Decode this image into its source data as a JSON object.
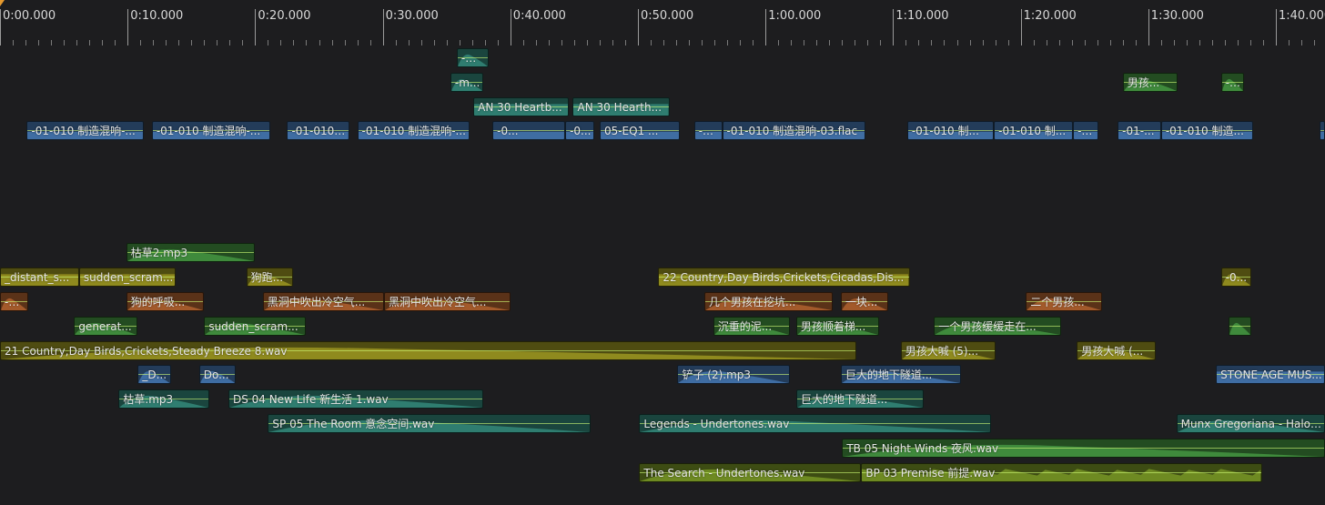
{
  "timeline": {
    "time_labels": [
      "0:00.000",
      "0:10.000",
      "0:20.000",
      "0:30.000",
      "0:40.000",
      "0:50.000",
      "1:00.000",
      "1:10.000",
      "1:20.000",
      "1:30.000",
      "1:40.000"
    ]
  },
  "colors": {
    "blue": "#3f6da3",
    "green": "#3f8a3c",
    "teal": "#2f7d70",
    "orange": "#a35a2b",
    "olive": "#8f8a1e",
    "lime": "#6e8a22"
  },
  "clips": [
    {
      "label": "-m...",
      "start": 35.8,
      "end": 38.3,
      "row": 1,
      "color": "teal",
      "wave": "fade"
    },
    {
      "label": "-m...",
      "start": 35.3,
      "end": 37.9,
      "row": 2,
      "color": "teal",
      "wave": "fade"
    },
    {
      "label": "男孩...",
      "start": 88.0,
      "end": 92.3,
      "row": 2,
      "color": "green",
      "wave": "fade"
    },
    {
      "label": "-0...",
      "start": 95.7,
      "end": 97.5,
      "row": 2,
      "color": "green",
      "wave": "fade"
    },
    {
      "label": "AN 30 Heartb...",
      "start": 37.1,
      "end": 44.6,
      "row": 3,
      "color": "teal",
      "wave": "steady"
    },
    {
      "label": "AN 30 Hearth...",
      "start": 44.9,
      "end": 52.5,
      "row": 3,
      "color": "teal",
      "wave": "steady"
    },
    {
      "label": "-01-010 制造混响-...",
      "start": 2.1,
      "end": 11.3,
      "row": 4,
      "color": "blue",
      "wave": "flat"
    },
    {
      "label": "-01-010 制造混响-...",
      "start": 11.9,
      "end": 21.2,
      "row": 4,
      "color": "blue",
      "wave": "flat"
    },
    {
      "label": "-01-010 ...",
      "start": 22.5,
      "end": 27.4,
      "row": 4,
      "color": "blue",
      "wave": "flat"
    },
    {
      "label": "-01-010 制造混响-...",
      "start": 28.0,
      "end": 36.8,
      "row": 4,
      "color": "blue",
      "wave": "flat"
    },
    {
      "label": "-0...",
      "start": 38.6,
      "end": 44.3,
      "row": 4,
      "color": "blue",
      "wave": "flat"
    },
    {
      "label": "-0...",
      "start": 44.3,
      "end": 46.6,
      "row": 4,
      "color": "blue",
      "wave": "flat"
    },
    {
      "label": "05-EQ1 ...",
      "start": 47.0,
      "end": 53.3,
      "row": 4,
      "color": "blue",
      "wave": "flat"
    },
    {
      "label": "-0...",
      "start": 54.4,
      "end": 56.6,
      "row": 4,
      "color": "blue",
      "wave": "flat"
    },
    {
      "label": "-01-010 制造混响-03.flac",
      "start": 56.6,
      "end": 67.8,
      "row": 4,
      "color": "blue",
      "wave": "flat"
    },
    {
      "label": "-01-010 制...",
      "start": 71.1,
      "end": 77.9,
      "row": 4,
      "color": "blue",
      "wave": "flat"
    },
    {
      "label": "-01-010 制...",
      "start": 77.9,
      "end": 84.1,
      "row": 4,
      "color": "blue",
      "wave": "flat"
    },
    {
      "label": "-0...",
      "start": 84.1,
      "end": 86.1,
      "row": 4,
      "color": "blue",
      "wave": "flat"
    },
    {
      "label": "-01-...",
      "start": 87.6,
      "end": 91.0,
      "row": 4,
      "color": "blue",
      "wave": "flat"
    },
    {
      "label": "-01-010 制造...",
      "start": 91.0,
      "end": 98.2,
      "row": 4,
      "color": "blue",
      "wave": "flat"
    },
    {
      "label": "",
      "start": 103.4,
      "end": 104.0,
      "row": 4,
      "color": "blue",
      "wave": "flat"
    },
    {
      "label": "枯草2.mp3",
      "start": 9.9,
      "end": 20.0,
      "row": 9,
      "color": "green",
      "wave": "fade"
    },
    {
      "label": "_distant_s...",
      "start": 0.0,
      "end": 6.2,
      "row": 10,
      "color": "olive",
      "wave": "steady"
    },
    {
      "label": "sudden_scram...",
      "start": 6.2,
      "end": 13.8,
      "row": 10,
      "color": "olive",
      "wave": "steady"
    },
    {
      "label": "狗跑...",
      "start": 19.3,
      "end": 23.0,
      "row": 10,
      "color": "olive",
      "wave": "fade"
    },
    {
      "label": "22 Country,Day Birds,Crickets,Cicadas,Dis...",
      "start": 51.6,
      "end": 71.3,
      "row": 10,
      "color": "olive",
      "wave": "steady"
    },
    {
      "label": "-0...",
      "start": 95.7,
      "end": 98.1,
      "row": 10,
      "color": "olive",
      "wave": "fade"
    },
    {
      "label": "-m...",
      "start": 0.0,
      "end": 2.2,
      "row": 11,
      "color": "orange",
      "wave": "fade"
    },
    {
      "label": "狗的呼吸...",
      "start": 9.9,
      "end": 16.0,
      "row": 11,
      "color": "orange",
      "wave": "fade"
    },
    {
      "label": "黑洞中吹出冷空气...",
      "start": 20.6,
      "end": 30.1,
      "row": 11,
      "color": "orange",
      "wave": "fade"
    },
    {
      "label": "黑洞中吹出冷空气...",
      "start": 30.1,
      "end": 40.0,
      "row": 11,
      "color": "orange",
      "wave": "fade"
    },
    {
      "label": "几个男孩在挖坑...",
      "start": 55.2,
      "end": 65.3,
      "row": 11,
      "color": "orange",
      "wave": "fade"
    },
    {
      "label": "一块...",
      "start": 65.9,
      "end": 69.6,
      "row": 11,
      "color": "orange",
      "wave": "fade"
    },
    {
      "label": "二个男孩...",
      "start": 80.4,
      "end": 86.4,
      "row": 11,
      "color": "orange",
      "wave": "fade"
    },
    {
      "label": "generat...",
      "start": 5.8,
      "end": 10.8,
      "row": 12,
      "color": "green",
      "wave": "fade"
    },
    {
      "label": "sudden_scram...",
      "start": 16.0,
      "end": 24.0,
      "row": 12,
      "color": "green",
      "wave": "fade"
    },
    {
      "label": "沉重的泥...",
      "start": 55.9,
      "end": 61.9,
      "row": 12,
      "color": "green",
      "wave": "fade"
    },
    {
      "label": "男孩顺着梯...",
      "start": 62.4,
      "end": 68.9,
      "row": 12,
      "color": "green",
      "wave": "fade"
    },
    {
      "label": "一个男孩缓缓走在...",
      "start": 73.2,
      "end": 83.2,
      "row": 12,
      "color": "green",
      "wave": "fade"
    },
    {
      "label": "",
      "start": 96.3,
      "end": 98.1,
      "row": 12,
      "color": "green",
      "wave": "fade"
    },
    {
      "label": "21 Country,Day Birds,Crickets,Steady Breeze 8.wav",
      "start": 0.0,
      "end": 67.1,
      "row": 13,
      "color": "olive",
      "wave": "fade"
    },
    {
      "label": "男孩大喊 (5)...",
      "start": 70.6,
      "end": 78.0,
      "row": 13,
      "color": "olive",
      "wave": "fade"
    },
    {
      "label": "男孩大喊 (...",
      "start": 84.4,
      "end": 90.6,
      "row": 13,
      "color": "olive",
      "wave": "fade"
    },
    {
      "label": "_D...",
      "start": 10.8,
      "end": 13.4,
      "row": 14,
      "color": "blue",
      "wave": "fade"
    },
    {
      "label": "Do...",
      "start": 15.6,
      "end": 18.5,
      "row": 14,
      "color": "blue",
      "wave": "fade"
    },
    {
      "label": "铲子 (2).mp3",
      "start": 53.1,
      "end": 61.9,
      "row": 14,
      "color": "blue",
      "wave": "fade"
    },
    {
      "label": "巨大的地下隧道...",
      "start": 65.9,
      "end": 75.3,
      "row": 14,
      "color": "blue",
      "wave": "fade"
    },
    {
      "label": "STONE AGE MUS...",
      "start": 95.3,
      "end": 104.0,
      "row": 14,
      "color": "blue",
      "wave": "steady"
    },
    {
      "label": "枯草.mp3",
      "start": 9.3,
      "end": 16.4,
      "row": 15,
      "color": "teal",
      "wave": "fade"
    },
    {
      "label": "DS 04 New Life 新生活 1.wav",
      "start": 17.9,
      "end": 37.9,
      "row": 15,
      "color": "teal",
      "wave": "fade"
    },
    {
      "label": "巨大的地下隧道...",
      "start": 62.4,
      "end": 72.4,
      "row": 15,
      "color": "teal",
      "wave": "fade"
    },
    {
      "label": "SP 05 The Room 意念空间.wav",
      "start": 21.0,
      "end": 46.3,
      "row": 16,
      "color": "teal",
      "wave": "fade"
    },
    {
      "label": "Legends - Undertones.wav",
      "start": 50.1,
      "end": 77.7,
      "row": 16,
      "color": "teal",
      "wave": "fade"
    },
    {
      "label": "Munx Gregoriana - Halo T...",
      "start": 92.2,
      "end": 104.0,
      "row": 16,
      "color": "teal",
      "wave": "fade"
    },
    {
      "label": "TB 05 Night Winds 夜风.wav",
      "start": 66.0,
      "end": 104.0,
      "row": 17,
      "color": "green",
      "wave": "fade"
    },
    {
      "label": "The Search - Undertones.wav",
      "start": 50.1,
      "end": 67.5,
      "row": 18,
      "color": "lime",
      "wave": "fade"
    },
    {
      "label": "BP 03 Premise 前提.wav",
      "start": 67.5,
      "end": 98.9,
      "row": 18,
      "color": "lime",
      "wave": "spiky"
    }
  ]
}
